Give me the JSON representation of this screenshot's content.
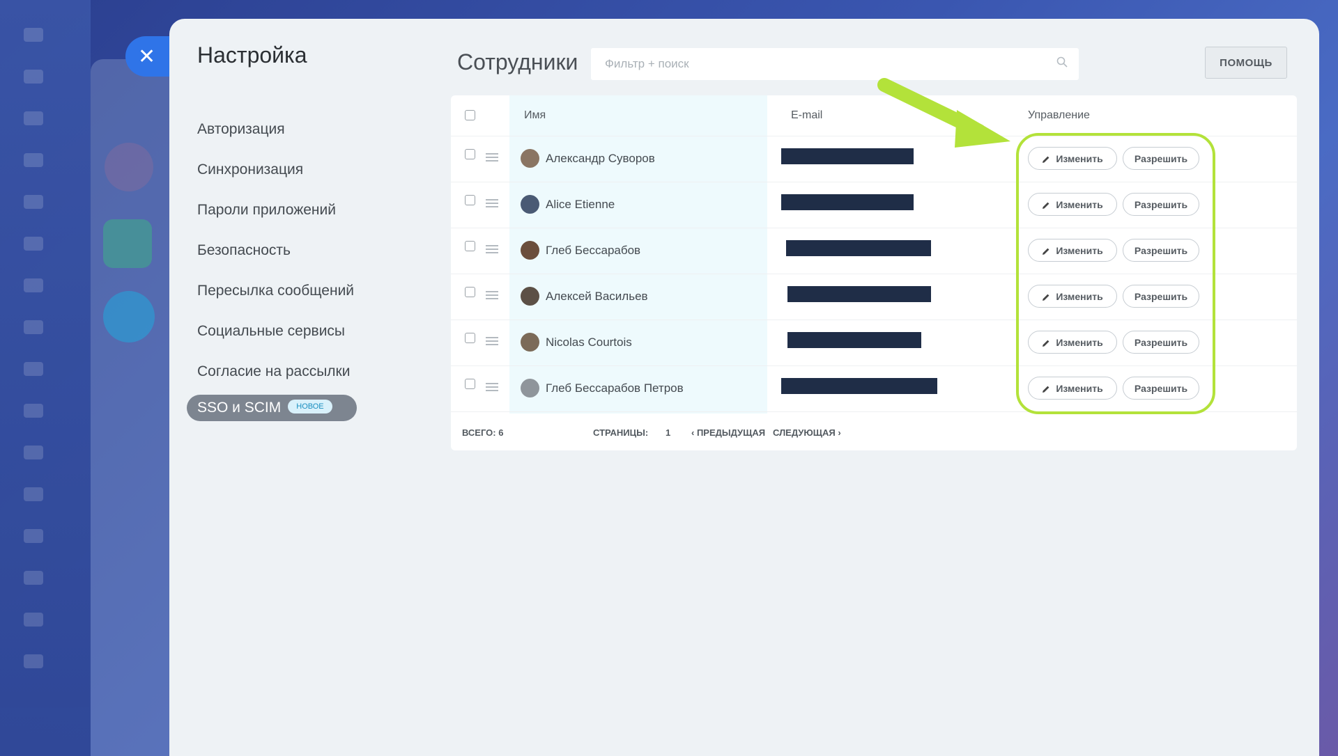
{
  "settings": {
    "title": "Настройка",
    "menu": [
      {
        "label": "Авторизация"
      },
      {
        "label": "Синхронизация"
      },
      {
        "label": "Пароли приложений"
      },
      {
        "label": "Безопасность"
      },
      {
        "label": "Пересылка сообщений"
      },
      {
        "label": "Социальные сервисы"
      },
      {
        "label": "Согласие на рассылки"
      }
    ],
    "active_item": {
      "label": "SSO и SCIM",
      "badge": "НОВОЕ"
    }
  },
  "employees": {
    "title": "Сотрудники",
    "search_placeholder": "Фильтр + поиск",
    "help_label": "ПОМОЩЬ",
    "columns": {
      "name": "Имя",
      "email": "E-mail",
      "actions": "Управление"
    },
    "edit_label": "Изменить",
    "allow_label": "Разрешить",
    "rows": [
      {
        "name": "Александр Суворов"
      },
      {
        "name": "Alice Etienne"
      },
      {
        "name": "Глеб Бессарабов"
      },
      {
        "name": "Алексей Васильев"
      },
      {
        "name": "Nicolas Courtois"
      },
      {
        "name": "Глеб Бессарабов Петров"
      }
    ],
    "footer": {
      "total": "ВСЕГО: 6",
      "pages": "СТРАНИЦЫ:",
      "page_num": "1",
      "prev": "ПРЕДЫДУЩАЯ",
      "next": "СЛЕДУЮЩАЯ"
    }
  },
  "colors": {
    "accent": "#2f74e8",
    "highlight": "#b3e23a",
    "redaction": "#1f2d47"
  }
}
